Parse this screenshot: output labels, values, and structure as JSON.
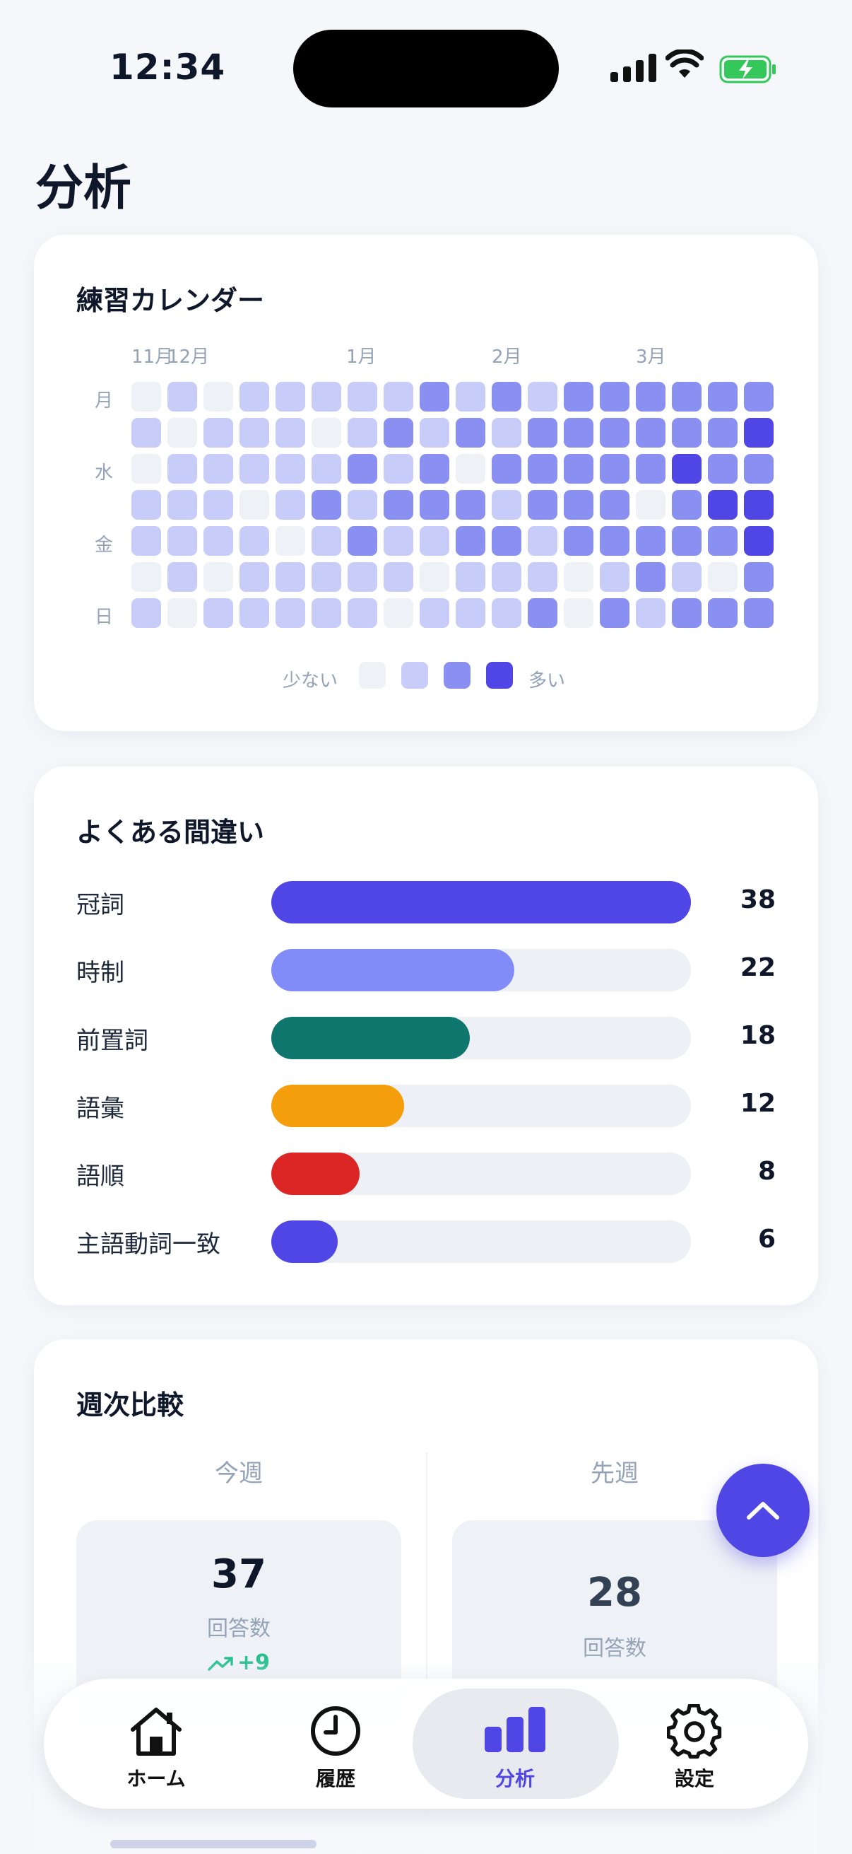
{
  "status_bar": {
    "time": "12:34"
  },
  "page": {
    "title": "分析"
  },
  "calendar": {
    "title": "練習カレンダー",
    "months": [
      "11月",
      "12月",
      "1月",
      "2月",
      "3月"
    ],
    "day_labels": [
      "月",
      "水",
      "金",
      "日"
    ],
    "legend": {
      "less": "少ない",
      "more": "多い"
    },
    "level_colors": [
      "#eef1f6",
      "#c7cdf8",
      "#8a8ff2",
      "#4f46e5"
    ],
    "levels": [
      [
        0,
        1,
        0,
        1,
        1,
        1,
        1,
        1,
        2,
        1,
        2,
        1,
        2,
        2,
        2,
        2,
        2,
        2
      ],
      [
        1,
        0,
        1,
        1,
        1,
        0,
        1,
        2,
        1,
        2,
        1,
        2,
        2,
        2,
        2,
        2,
        2,
        3
      ],
      [
        0,
        1,
        1,
        1,
        1,
        1,
        2,
        1,
        2,
        0,
        2,
        2,
        2,
        2,
        2,
        3,
        2,
        2
      ],
      [
        1,
        1,
        1,
        0,
        1,
        2,
        1,
        2,
        2,
        2,
        1,
        2,
        2,
        2,
        0,
        2,
        3,
        3
      ],
      [
        1,
        1,
        1,
        1,
        0,
        1,
        2,
        1,
        1,
        2,
        2,
        1,
        2,
        2,
        2,
        2,
        2,
        3
      ],
      [
        0,
        1,
        0,
        1,
        1,
        1,
        1,
        1,
        0,
        1,
        1,
        1,
        0,
        1,
        2,
        1,
        0,
        2
      ],
      [
        1,
        0,
        1,
        1,
        1,
        1,
        1,
        0,
        1,
        1,
        1,
        2,
        0,
        2,
        1,
        2,
        2,
        2
      ]
    ]
  },
  "mistakes": {
    "title": "よくある間違い",
    "max": 38,
    "items": [
      {
        "label": "冠詞",
        "count": 38,
        "color": "#4f46e5"
      },
      {
        "label": "時制",
        "count": 22,
        "color": "#818cf8"
      },
      {
        "label": "前置詞",
        "count": 18,
        "color": "#0f766e"
      },
      {
        "label": "語彙",
        "count": 12,
        "color": "#f59e0b"
      },
      {
        "label": "語順",
        "count": 8,
        "color": "#dc2626"
      },
      {
        "label": "主語動詞一致",
        "count": 6,
        "color": "#4f46e5"
      }
    ]
  },
  "weekly": {
    "title": "週次比較",
    "this_week": {
      "heading": "今週",
      "answers": "37",
      "answers_label": "回答数",
      "delta": "+9"
    },
    "last_week": {
      "heading": "先週",
      "answers": "28",
      "answers_label": "回答数"
    }
  },
  "tabbar": {
    "items": [
      {
        "label": "ホーム",
        "icon": "home-icon"
      },
      {
        "label": "履歴",
        "icon": "clock-icon"
      },
      {
        "label": "分析",
        "icon": "bar-chart-icon",
        "active": true
      },
      {
        "label": "設定",
        "icon": "gear-icon"
      }
    ]
  }
}
